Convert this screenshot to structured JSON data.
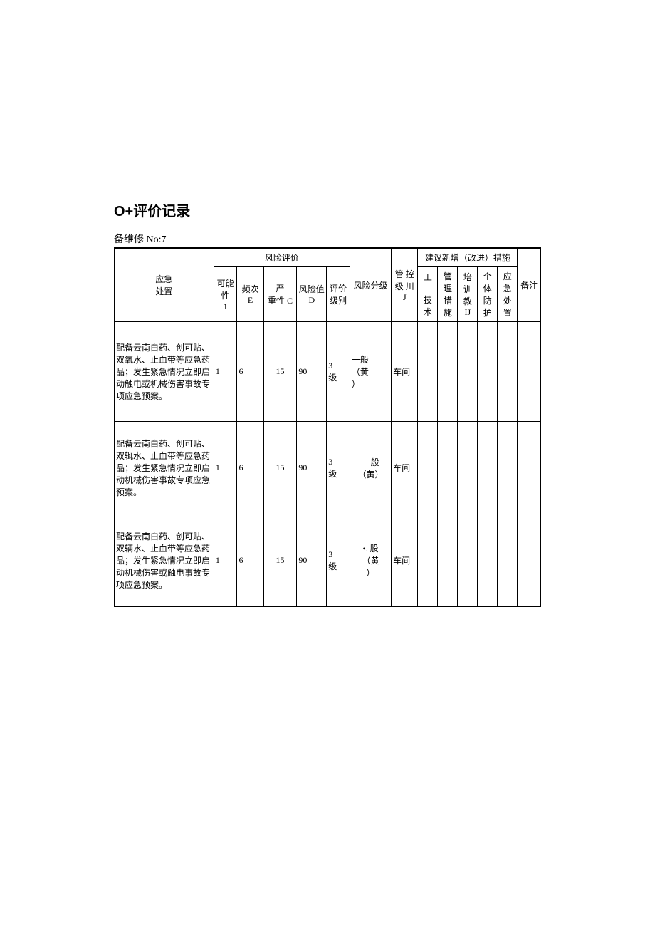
{
  "page": {
    "title": "O+评价记录",
    "subtitle": "备维修 No:7"
  },
  "headers": {
    "risk_eval": "风险评价",
    "suggestions": "建议新增（改进）措施",
    "emergency": "应急\n处置",
    "possibility": "可能性\n1",
    "frequency": "频次\nE",
    "severity": "严\n重性 C",
    "risk_value": "风险值\nD",
    "eval_level": "评价\n级别",
    "risk_grade": "风险分级",
    "control_level": "管 控\n级 川\nJ",
    "eng_tech": "工\n\n技\n术",
    "mgmt_measure": "管\n理\n措\n施",
    "train_edu": "培\n训\n教\nIJ",
    "ppe": "个\n体\n防\n护",
    "emergency_disposal": "应\n急\n处\n置",
    "remark": "备注"
  },
  "rows": [
    {
      "emergency": "配备云南白药、创可贴、双氧水、止血带等应急药品；发生紧急情况立即启动触电或机械伤害事故专项应急预案。",
      "possibility": "1",
      "frequency": "6",
      "severity": "15",
      "risk_value": "90",
      "eval_level": "3\n级",
      "risk_grade": "一般\n（黄\n）",
      "control_level": "车间",
      "eng_tech": "",
      "mgmt_measure": "",
      "train_edu": "",
      "ppe": "",
      "emergency_disposal": "",
      "remark": ""
    },
    {
      "emergency": "配备云南白药、创可贴、双辄水、止血带等应急药品；发生紧急情况立即启动机械伤害事故专项应急预案。",
      "possibility": "1",
      "frequency": "6",
      "severity": "15",
      "risk_value": "90",
      "eval_level": "3\n级",
      "risk_grade": "一般\n（黄）",
      "control_level": "车间",
      "eng_tech": "",
      "mgmt_measure": "",
      "train_edu": "",
      "ppe": "",
      "emergency_disposal": "",
      "remark": ""
    },
    {
      "emergency": "配备云南白药、创可贴、双辆水、止血带等应急药品；发生紧急情况立即启动机械伤害或触电事故专项应急预案。",
      "possibility": "1",
      "frequency": "6",
      "severity": "15",
      "risk_value": "90",
      "eval_level": "3\n级",
      "risk_grade": "•. 股\n（黄\n）",
      "control_level": "车间",
      "eng_tech": "",
      "mgmt_measure": "",
      "train_edu": "",
      "ppe": "",
      "emergency_disposal": "",
      "remark": ""
    }
  ]
}
